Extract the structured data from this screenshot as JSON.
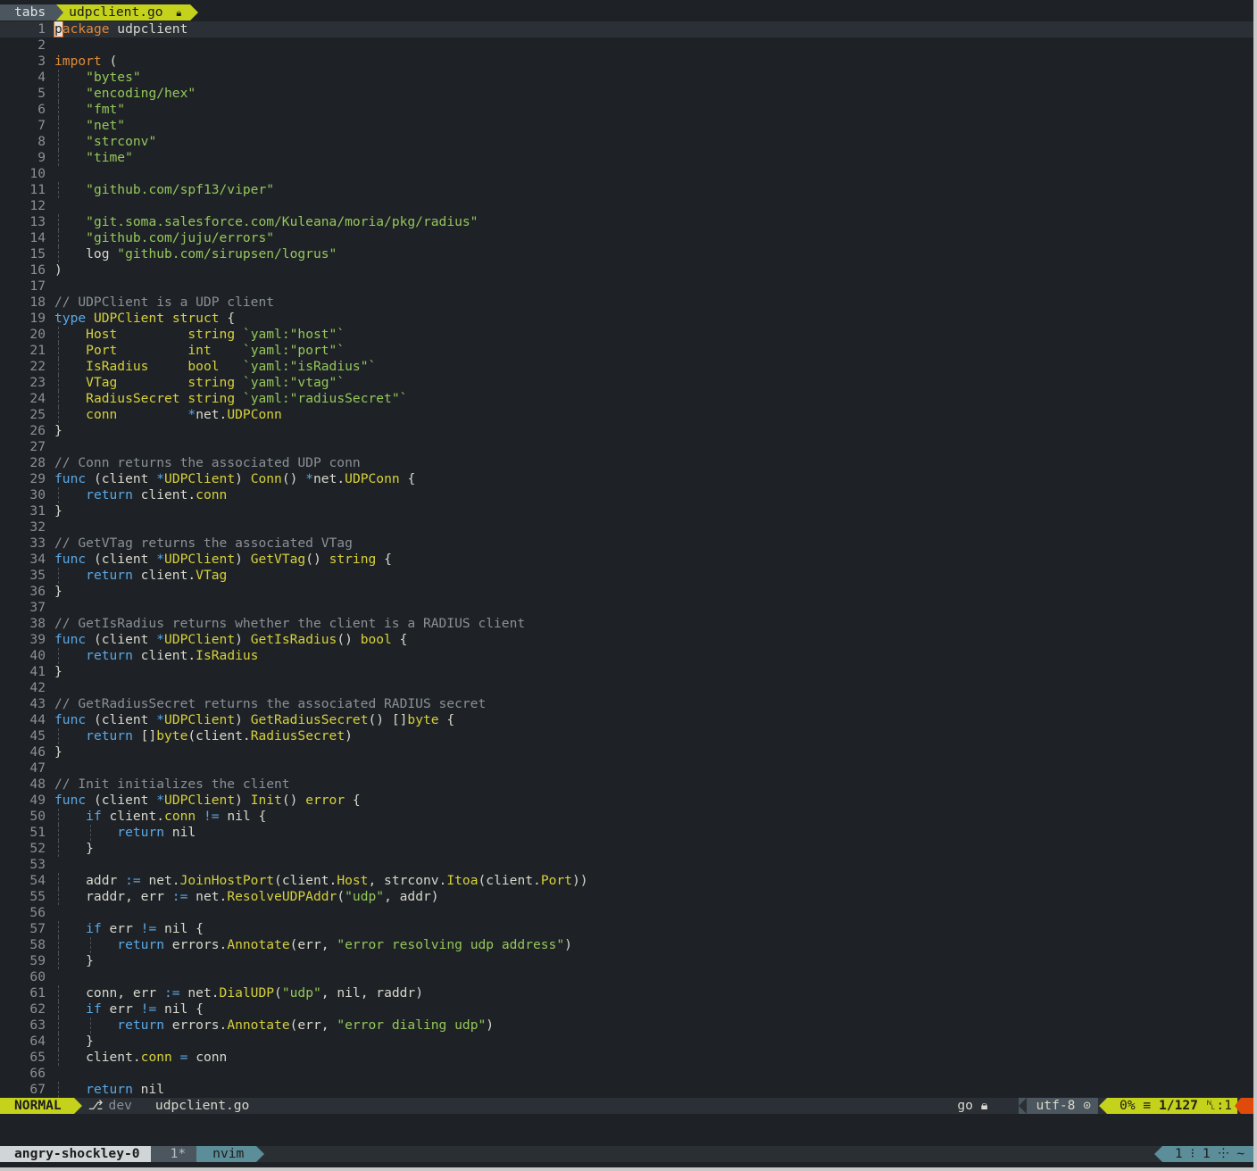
{
  "tabline": {
    "label": "tabs",
    "active_tab": "udpclient.go",
    "lock_icon": "lock-icon"
  },
  "statusline": {
    "mode": "NORMAL",
    "branch_icon": "⎇",
    "branch": "dev",
    "filename": "udpclient.go",
    "filetype": "go",
    "encoding": "utf-8",
    "percent": "0%",
    "position": "1/127",
    "column": ":1"
  },
  "tmux": {
    "session": "angry-shockley-0",
    "window_index": "1*",
    "window_name": "nvim",
    "right": "1 ⁝ 1 ⸭ ~"
  },
  "lines": [
    [
      {
        "c": "pk",
        "t": "package"
      },
      {
        "c": "pl",
        "t": " udpclient"
      }
    ],
    [],
    [
      {
        "c": "pk",
        "t": "import"
      },
      {
        "c": "pl",
        "t": " ("
      }
    ],
    [
      {
        "c": "pl",
        "t": "    "
      },
      {
        "c": "str",
        "t": "\"bytes\""
      }
    ],
    [
      {
        "c": "pl",
        "t": "    "
      },
      {
        "c": "str",
        "t": "\"encoding/hex\""
      }
    ],
    [
      {
        "c": "pl",
        "t": "    "
      },
      {
        "c": "str",
        "t": "\"fmt\""
      }
    ],
    [
      {
        "c": "pl",
        "t": "    "
      },
      {
        "c": "str",
        "t": "\"net\""
      }
    ],
    [
      {
        "c": "pl",
        "t": "    "
      },
      {
        "c": "str",
        "t": "\"strconv\""
      }
    ],
    [
      {
        "c": "pl",
        "t": "    "
      },
      {
        "c": "str",
        "t": "\"time\""
      }
    ],
    [],
    [
      {
        "c": "pl",
        "t": "    "
      },
      {
        "c": "str",
        "t": "\"github.com/spf13/viper\""
      }
    ],
    [],
    [
      {
        "c": "pl",
        "t": "    "
      },
      {
        "c": "str",
        "t": "\"git.soma.salesforce.com/Kuleana/moria/pkg/radius\""
      }
    ],
    [
      {
        "c": "pl",
        "t": "    "
      },
      {
        "c": "str",
        "t": "\"github.com/juju/errors\""
      }
    ],
    [
      {
        "c": "pl",
        "t": "    log "
      },
      {
        "c": "str",
        "t": "\"github.com/sirupsen/logrus\""
      }
    ],
    [
      {
        "c": "pl",
        "t": ")"
      }
    ],
    [],
    [
      {
        "c": "cm",
        "t": "// UDPClient is a UDP client"
      }
    ],
    [
      {
        "c": "kw",
        "t": "type"
      },
      {
        "c": "pl",
        "t": " "
      },
      {
        "c": "ty",
        "t": "UDPClient"
      },
      {
        "c": "pl",
        "t": " "
      },
      {
        "c": "ty",
        "t": "struct"
      },
      {
        "c": "pl",
        "t": " {"
      }
    ],
    [
      {
        "c": "pl",
        "t": "    "
      },
      {
        "c": "fld",
        "t": "Host"
      },
      {
        "c": "pl",
        "t": "         "
      },
      {
        "c": "ty",
        "t": "string"
      },
      {
        "c": "pl",
        "t": " "
      },
      {
        "c": "str",
        "t": "`yaml:\"host\"`"
      }
    ],
    [
      {
        "c": "pl",
        "t": "    "
      },
      {
        "c": "fld",
        "t": "Port"
      },
      {
        "c": "pl",
        "t": "         "
      },
      {
        "c": "ty",
        "t": "int"
      },
      {
        "c": "pl",
        "t": "    "
      },
      {
        "c": "str",
        "t": "`yaml:\"port\"`"
      }
    ],
    [
      {
        "c": "pl",
        "t": "    "
      },
      {
        "c": "fld",
        "t": "IsRadius"
      },
      {
        "c": "pl",
        "t": "     "
      },
      {
        "c": "ty",
        "t": "bool"
      },
      {
        "c": "pl",
        "t": "   "
      },
      {
        "c": "str",
        "t": "`yaml:\"isRadius\"`"
      }
    ],
    [
      {
        "c": "pl",
        "t": "    "
      },
      {
        "c": "fld",
        "t": "VTag"
      },
      {
        "c": "pl",
        "t": "         "
      },
      {
        "c": "ty",
        "t": "string"
      },
      {
        "c": "pl",
        "t": " "
      },
      {
        "c": "str",
        "t": "`yaml:\"vtag\"`"
      }
    ],
    [
      {
        "c": "pl",
        "t": "    "
      },
      {
        "c": "fld",
        "t": "RadiusSecret"
      },
      {
        "c": "pl",
        "t": " "
      },
      {
        "c": "ty",
        "t": "string"
      },
      {
        "c": "pl",
        "t": " "
      },
      {
        "c": "str",
        "t": "`yaml:\"radiusSecret\"`"
      }
    ],
    [
      {
        "c": "pl",
        "t": "    "
      },
      {
        "c": "fld",
        "t": "conn"
      },
      {
        "c": "pl",
        "t": "         "
      },
      {
        "c": "op",
        "t": "*"
      },
      {
        "c": "pl",
        "t": "net."
      },
      {
        "c": "ty",
        "t": "UDPConn"
      }
    ],
    [
      {
        "c": "pl",
        "t": "}"
      }
    ],
    [],
    [
      {
        "c": "cm",
        "t": "// Conn returns the associated UDP conn"
      }
    ],
    [
      {
        "c": "kw",
        "t": "func"
      },
      {
        "c": "pl",
        "t": " (client "
      },
      {
        "c": "op",
        "t": "*"
      },
      {
        "c": "ty",
        "t": "UDPClient"
      },
      {
        "c": "pl",
        "t": ") "
      },
      {
        "c": "fn",
        "t": "Conn"
      },
      {
        "c": "pl",
        "t": "() "
      },
      {
        "c": "op",
        "t": "*"
      },
      {
        "c": "pl",
        "t": "net."
      },
      {
        "c": "ty",
        "t": "UDPConn"
      },
      {
        "c": "pl",
        "t": " {"
      }
    ],
    [
      {
        "c": "pl",
        "t": "    "
      },
      {
        "c": "kw",
        "t": "return"
      },
      {
        "c": "pl",
        "t": " client."
      },
      {
        "c": "fld",
        "t": "conn"
      }
    ],
    [
      {
        "c": "pl",
        "t": "}"
      }
    ],
    [],
    [
      {
        "c": "cm",
        "t": "// GetVTag returns the associated VTag"
      }
    ],
    [
      {
        "c": "kw",
        "t": "func"
      },
      {
        "c": "pl",
        "t": " (client "
      },
      {
        "c": "op",
        "t": "*"
      },
      {
        "c": "ty",
        "t": "UDPClient"
      },
      {
        "c": "pl",
        "t": ") "
      },
      {
        "c": "fn",
        "t": "GetVTag"
      },
      {
        "c": "pl",
        "t": "() "
      },
      {
        "c": "ty",
        "t": "string"
      },
      {
        "c": "pl",
        "t": " {"
      }
    ],
    [
      {
        "c": "pl",
        "t": "    "
      },
      {
        "c": "kw",
        "t": "return"
      },
      {
        "c": "pl",
        "t": " client."
      },
      {
        "c": "fld",
        "t": "VTag"
      }
    ],
    [
      {
        "c": "pl",
        "t": "}"
      }
    ],
    [],
    [
      {
        "c": "cm",
        "t": "// GetIsRadius returns whether the client is a RADIUS client"
      }
    ],
    [
      {
        "c": "kw",
        "t": "func"
      },
      {
        "c": "pl",
        "t": " (client "
      },
      {
        "c": "op",
        "t": "*"
      },
      {
        "c": "ty",
        "t": "UDPClient"
      },
      {
        "c": "pl",
        "t": ") "
      },
      {
        "c": "fn",
        "t": "GetIsRadius"
      },
      {
        "c": "pl",
        "t": "() "
      },
      {
        "c": "ty",
        "t": "bool"
      },
      {
        "c": "pl",
        "t": " {"
      }
    ],
    [
      {
        "c": "pl",
        "t": "    "
      },
      {
        "c": "kw",
        "t": "return"
      },
      {
        "c": "pl",
        "t": " client."
      },
      {
        "c": "fld",
        "t": "IsRadius"
      }
    ],
    [
      {
        "c": "pl",
        "t": "}"
      }
    ],
    [],
    [
      {
        "c": "cm",
        "t": "// GetRadiusSecret returns the associated RADIUS secret"
      }
    ],
    [
      {
        "c": "kw",
        "t": "func"
      },
      {
        "c": "pl",
        "t": " (client "
      },
      {
        "c": "op",
        "t": "*"
      },
      {
        "c": "ty",
        "t": "UDPClient"
      },
      {
        "c": "pl",
        "t": ") "
      },
      {
        "c": "fn",
        "t": "GetRadiusSecret"
      },
      {
        "c": "pl",
        "t": "() []"
      },
      {
        "c": "ty",
        "t": "byte"
      },
      {
        "c": "pl",
        "t": " {"
      }
    ],
    [
      {
        "c": "pl",
        "t": "    "
      },
      {
        "c": "kw",
        "t": "return"
      },
      {
        "c": "pl",
        "t": " []"
      },
      {
        "c": "ty",
        "t": "byte"
      },
      {
        "c": "pl",
        "t": "(client."
      },
      {
        "c": "fld",
        "t": "RadiusSecret"
      },
      {
        "c": "pl",
        "t": ")"
      }
    ],
    [
      {
        "c": "pl",
        "t": "}"
      }
    ],
    [],
    [
      {
        "c": "cm",
        "t": "// Init initializes the client"
      }
    ],
    [
      {
        "c": "kw",
        "t": "func"
      },
      {
        "c": "pl",
        "t": " (client "
      },
      {
        "c": "op",
        "t": "*"
      },
      {
        "c": "ty",
        "t": "UDPClient"
      },
      {
        "c": "pl",
        "t": ") "
      },
      {
        "c": "fn",
        "t": "Init"
      },
      {
        "c": "pl",
        "t": "() "
      },
      {
        "c": "ty",
        "t": "error"
      },
      {
        "c": "pl",
        "t": " {"
      }
    ],
    [
      {
        "c": "pl",
        "t": "    "
      },
      {
        "c": "kw",
        "t": "if"
      },
      {
        "c": "pl",
        "t": " client."
      },
      {
        "c": "fld",
        "t": "conn"
      },
      {
        "c": "pl",
        "t": " "
      },
      {
        "c": "op",
        "t": "!="
      },
      {
        "c": "pl",
        "t": " nil {"
      }
    ],
    [
      {
        "c": "pl",
        "t": "        "
      },
      {
        "c": "kw",
        "t": "return"
      },
      {
        "c": "pl",
        "t": " nil"
      }
    ],
    [
      {
        "c": "pl",
        "t": "    }"
      }
    ],
    [],
    [
      {
        "c": "pl",
        "t": "    addr "
      },
      {
        "c": "op",
        "t": ":="
      },
      {
        "c": "pl",
        "t": " net."
      },
      {
        "c": "fn",
        "t": "JoinHostPort"
      },
      {
        "c": "pl",
        "t": "(client."
      },
      {
        "c": "fld",
        "t": "Host"
      },
      {
        "c": "pl",
        "t": ", strconv."
      },
      {
        "c": "fn",
        "t": "Itoa"
      },
      {
        "c": "pl",
        "t": "(client."
      },
      {
        "c": "fld",
        "t": "Port"
      },
      {
        "c": "pl",
        "t": "))"
      }
    ],
    [
      {
        "c": "pl",
        "t": "    raddr, err "
      },
      {
        "c": "op",
        "t": ":="
      },
      {
        "c": "pl",
        "t": " net."
      },
      {
        "c": "fn",
        "t": "ResolveUDPAddr"
      },
      {
        "c": "pl",
        "t": "("
      },
      {
        "c": "str",
        "t": "\"udp\""
      },
      {
        "c": "pl",
        "t": ", addr)"
      }
    ],
    [],
    [
      {
        "c": "pl",
        "t": "    "
      },
      {
        "c": "kw",
        "t": "if"
      },
      {
        "c": "pl",
        "t": " err "
      },
      {
        "c": "op",
        "t": "!="
      },
      {
        "c": "pl",
        "t": " nil {"
      }
    ],
    [
      {
        "c": "pl",
        "t": "        "
      },
      {
        "c": "kw",
        "t": "return"
      },
      {
        "c": "pl",
        "t": " errors."
      },
      {
        "c": "fn",
        "t": "Annotate"
      },
      {
        "c": "pl",
        "t": "(err, "
      },
      {
        "c": "str",
        "t": "\"error resolving udp address\""
      },
      {
        "c": "pl",
        "t": ")"
      }
    ],
    [
      {
        "c": "pl",
        "t": "    }"
      }
    ],
    [],
    [
      {
        "c": "pl",
        "t": "    conn, err "
      },
      {
        "c": "op",
        "t": ":="
      },
      {
        "c": "pl",
        "t": " net."
      },
      {
        "c": "fn",
        "t": "DialUDP"
      },
      {
        "c": "pl",
        "t": "("
      },
      {
        "c": "str",
        "t": "\"udp\""
      },
      {
        "c": "pl",
        "t": ", nil, raddr)"
      }
    ],
    [
      {
        "c": "pl",
        "t": "    "
      },
      {
        "c": "kw",
        "t": "if"
      },
      {
        "c": "pl",
        "t": " err "
      },
      {
        "c": "op",
        "t": "!="
      },
      {
        "c": "pl",
        "t": " nil {"
      }
    ],
    [
      {
        "c": "pl",
        "t": "        "
      },
      {
        "c": "kw",
        "t": "return"
      },
      {
        "c": "pl",
        "t": " errors."
      },
      {
        "c": "fn",
        "t": "Annotate"
      },
      {
        "c": "pl",
        "t": "(err, "
      },
      {
        "c": "str",
        "t": "\"error dialing udp\""
      },
      {
        "c": "pl",
        "t": ")"
      }
    ],
    [
      {
        "c": "pl",
        "t": "    }"
      }
    ],
    [
      {
        "c": "pl",
        "t": "    client."
      },
      {
        "c": "fld",
        "t": "conn"
      },
      {
        "c": "pl",
        "t": " "
      },
      {
        "c": "op",
        "t": "="
      },
      {
        "c": "pl",
        "t": " conn"
      }
    ],
    [],
    [
      {
        "c": "pl",
        "t": "    "
      },
      {
        "c": "kw",
        "t": "return"
      },
      {
        "c": "pl",
        "t": " nil"
      }
    ]
  ]
}
